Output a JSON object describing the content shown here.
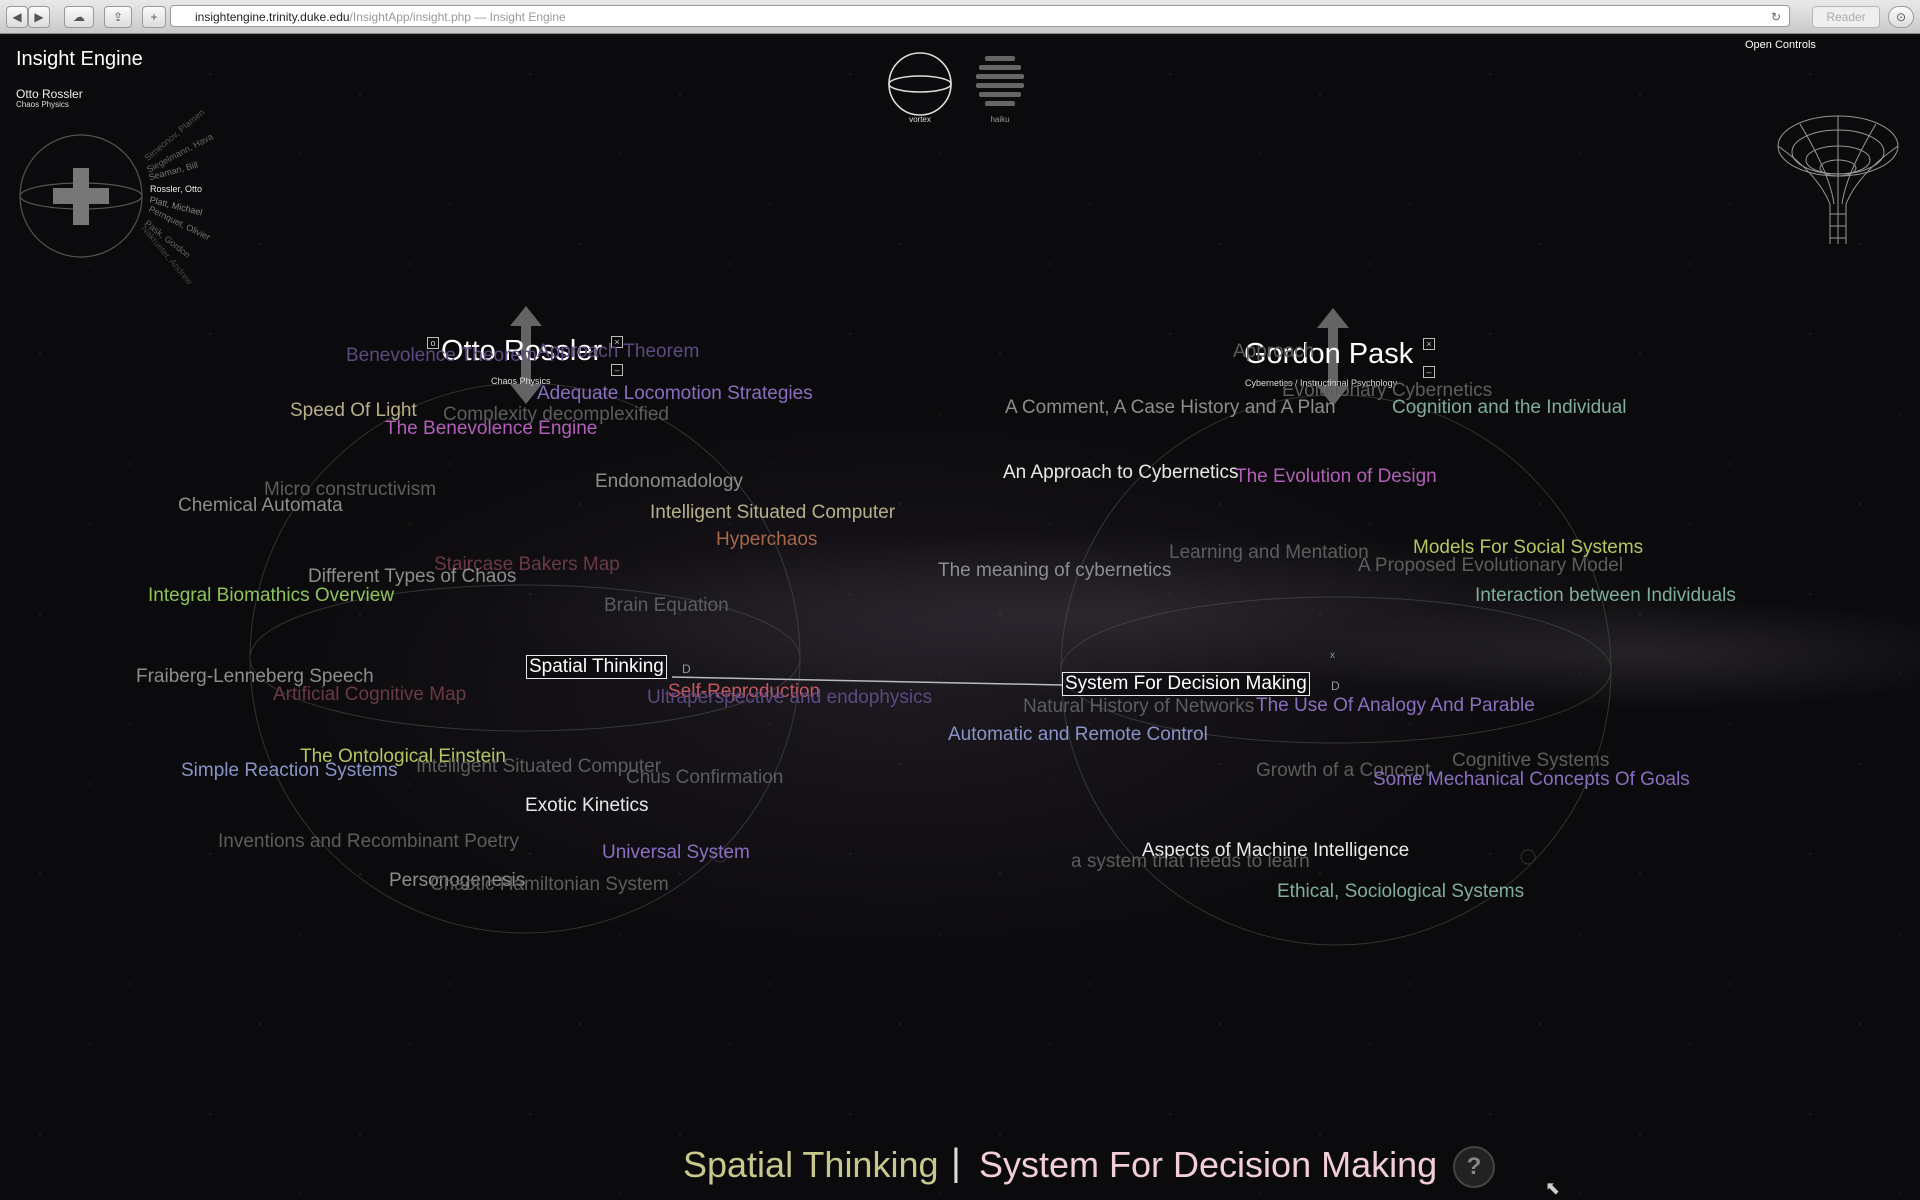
{
  "browser": {
    "url_host": "insightengine.trinity.duke.edu",
    "url_path": "/InsightApp/insight.php",
    "page_title": " — Insight Engine",
    "reader_label": "Reader"
  },
  "app": {
    "title": "Insight Engine",
    "open_controls": "Open Controls",
    "modes": [
      {
        "label": "vortex"
      },
      {
        "label": "haiku"
      }
    ]
  },
  "mini_panel": {
    "name": "Otto Rossler",
    "field": "Chaos Physics",
    "dial_names": [
      "Rossler, Otto",
      "Seaman, Bill",
      "Siegelmann, Hava",
      "Simeonov, Plamen",
      "Platt, Michael",
      "Pernquet, Olivier",
      "Pask, Gordon",
      "Nakrueter, Andrew"
    ]
  },
  "left_author": {
    "name": "Otto Rossler",
    "field": "Chaos Physics",
    "selected_topic": "Spatial Thinking",
    "topics": [
      {
        "text": "Benevolence Theorem",
        "c": "c-dpurp"
      },
      {
        "text": "Approach Theorem",
        "c": "c-dpurp"
      },
      {
        "text": "Adequate Locomotion Strategies",
        "c": "c-purple"
      },
      {
        "text": "Speed Of Light",
        "c": "c-tan"
      },
      {
        "text": "Complexity decomplexified",
        "c": "c-dgrey"
      },
      {
        "text": "The Benevolence Engine",
        "c": "c-mag"
      },
      {
        "text": "Endonomadology",
        "c": "c-grey"
      },
      {
        "text": "Micro constructivism",
        "c": "c-dgrey"
      },
      {
        "text": "Chemical Automata",
        "c": "c-grey"
      },
      {
        "text": "Intelligent Situated Computer",
        "c": "c-tan"
      },
      {
        "text": "Hyperchaos",
        "c": "c-orange"
      },
      {
        "text": "Staircase Bakers Map",
        "c": "c-dred"
      },
      {
        "text": "Different Types of Chaos",
        "c": "c-grey"
      },
      {
        "text": "Integral Biomathics Overview",
        "c": "c-green"
      },
      {
        "text": "Brain Equation",
        "c": "c-dgrey"
      },
      {
        "text": "Fraiberg-Lenneberg Speech",
        "c": "c-grey"
      },
      {
        "text": "Artificial Cognitive Map",
        "c": "c-dred"
      },
      {
        "text": "Self-Reproduction",
        "c": "c-red"
      },
      {
        "text": "Ultraperspective and endophysics",
        "c": "c-dpurp"
      },
      {
        "text": "The Ontological Einstein",
        "c": "c-olive"
      },
      {
        "text": "Simple Reaction Systems",
        "c": "c-blue"
      },
      {
        "text": "Intelligent Situated Computer",
        "c": "c-dgrey"
      },
      {
        "text": "Chus Confirmation",
        "c": "c-dgrey"
      },
      {
        "text": "Exotic Kinetics",
        "c": "c-white"
      },
      {
        "text": "Inventions and Recombinant Poetry",
        "c": "c-dgrey"
      },
      {
        "text": "Universal System",
        "c": "c-purple"
      },
      {
        "text": "Personogenesis",
        "c": "c-grey"
      },
      {
        "text": "Chaotic Hamiltonian System",
        "c": "c-dgrey"
      }
    ]
  },
  "right_author": {
    "name": "Gordon Pask",
    "field": "Cybernetics / Instructional Psychology",
    "selected_topic": "System For Decision Making",
    "topics": [
      {
        "text": "Approach",
        "c": "c-dgrey"
      },
      {
        "text": "Evolutionary Cybernetics",
        "c": "c-dgrey"
      },
      {
        "text": "A Comment, A Case History and A Plan",
        "c": "c-grey"
      },
      {
        "text": "Cognition and the Individual",
        "c": "c-teal"
      },
      {
        "text": "An Approach to Cybernetics",
        "c": "c-white"
      },
      {
        "text": "The Evolution of Design",
        "c": "c-mag"
      },
      {
        "text": "Learning and Mentation",
        "c": "c-dgrey"
      },
      {
        "text": "Models For Social Systems",
        "c": "c-olive"
      },
      {
        "text": "The meaning of cybernetics",
        "c": "c-grey"
      },
      {
        "text": "A Proposed Evolutionary Model",
        "c": "c-dgrey"
      },
      {
        "text": "Interaction between Individuals",
        "c": "c-teal"
      },
      {
        "text": "Natural History of Networks",
        "c": "c-dgrey"
      },
      {
        "text": "The Use Of Analogy And Parable",
        "c": "c-purple"
      },
      {
        "text": "Automatic and Remote Control",
        "c": "c-blue"
      },
      {
        "text": "Cognitive Systems",
        "c": "c-dgrey"
      },
      {
        "text": "Growth of a Concept",
        "c": "c-dgrey"
      },
      {
        "text": "Some Mechanical Concepts Of Goals",
        "c": "c-purple"
      },
      {
        "text": "Aspects of Machine Intelligence",
        "c": "c-white"
      },
      {
        "text": "a system that needs to learn",
        "c": "c-dgrey"
      },
      {
        "text": "Ethical, Sociological Systems",
        "c": "c-teal"
      }
    ]
  },
  "link_marks": {
    "delete_mark": "D",
    "x_mark": "x"
  },
  "footer": {
    "left": "Spatial Thinking",
    "separator": "|",
    "right": "System For Decision Making",
    "help": "?"
  },
  "colors": {
    "left_footer": "#c7c88c",
    "right_footer": "#f2cfd6",
    "background": "#0b0a0c"
  }
}
